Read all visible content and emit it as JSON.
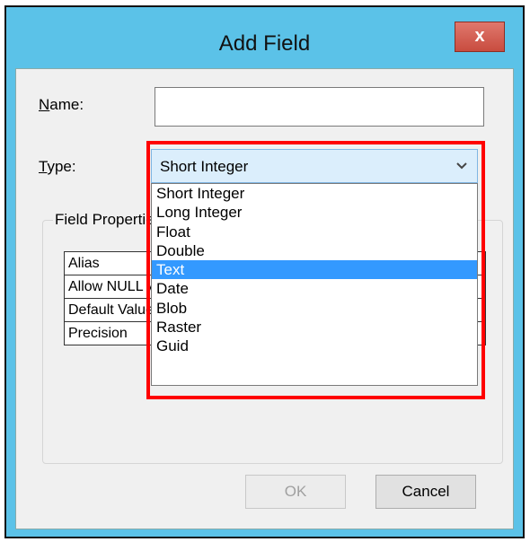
{
  "window": {
    "title": "Add Field",
    "close_glyph": "x"
  },
  "form": {
    "name_label_key": "N",
    "name_label_rest": "ame:",
    "name_value": "",
    "type_label_key": "T",
    "type_label_rest": "ype:"
  },
  "field_properties": {
    "caption": "Field Properties",
    "rows": [
      {
        "key": "Alias",
        "value": ""
      },
      {
        "key": "Allow NULL Values",
        "value": ""
      },
      {
        "key": "Default Value",
        "value": ""
      },
      {
        "key": "Precision",
        "value": ""
      }
    ]
  },
  "type_dropdown": {
    "selected_value": "Short Integer",
    "options": [
      "Short Integer",
      "Long Integer",
      "Float",
      "Double",
      "Text",
      "Date",
      "Blob",
      "Raster",
      "Guid"
    ],
    "highlighted_option": "Text"
  },
  "buttons": {
    "ok_label": "OK",
    "cancel_label": "Cancel"
  },
  "colors": {
    "title_bar": "#5bc2e8",
    "highlight_box": "#ff0000",
    "selection": "#3399ff"
  }
}
